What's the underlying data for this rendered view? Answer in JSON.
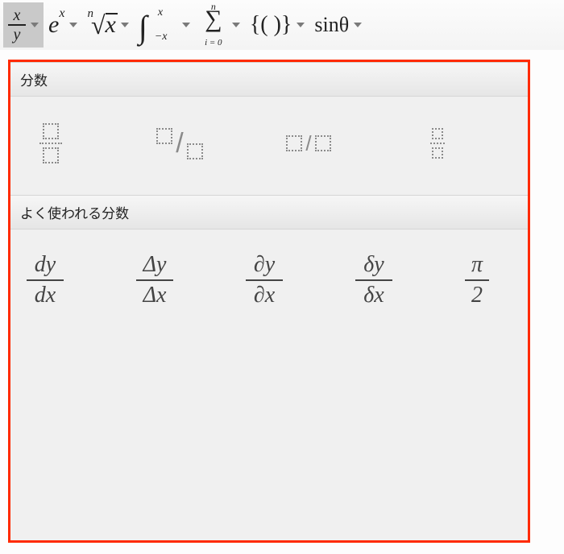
{
  "ribbon": {
    "fraction": {
      "top": "x",
      "bottom": "y",
      "name": "fraction-menu"
    },
    "exponent": {
      "base": "e",
      "sup": "x",
      "name": "exponent-menu"
    },
    "radical": {
      "index": "n",
      "radicand": "x",
      "name": "radical-menu"
    },
    "integral": {
      "low": "−x",
      "high": "x",
      "name": "integral-menu"
    },
    "sum": {
      "top": "n",
      "bottom": "i = 0",
      "name": "summation-menu"
    },
    "bracket": {
      "label": "{( )}",
      "name": "bracket-menu"
    },
    "trig": {
      "label": "sinθ",
      "name": "trig-menu"
    }
  },
  "panel": {
    "section1_title": "分数",
    "templates": [
      {
        "name": "stacked-fraction"
      },
      {
        "name": "skewed-fraction"
      },
      {
        "name": "linear-fraction"
      },
      {
        "name": "small-stacked-fraction"
      }
    ],
    "section2_title": "よく使われる分数",
    "common": [
      {
        "num": "dy",
        "den": "dx",
        "name": "dy-dx"
      },
      {
        "num": "Δy",
        "den": "Δx",
        "name": "delta-y-delta-x"
      },
      {
        "num": "∂y",
        "den": "∂x",
        "name": "partial-y-partial-x"
      },
      {
        "num": "δy",
        "den": "δx",
        "name": "small-delta-y-small-delta-x"
      },
      {
        "num": "π",
        "den": "2",
        "name": "pi-over-2"
      }
    ]
  },
  "slash": "/"
}
